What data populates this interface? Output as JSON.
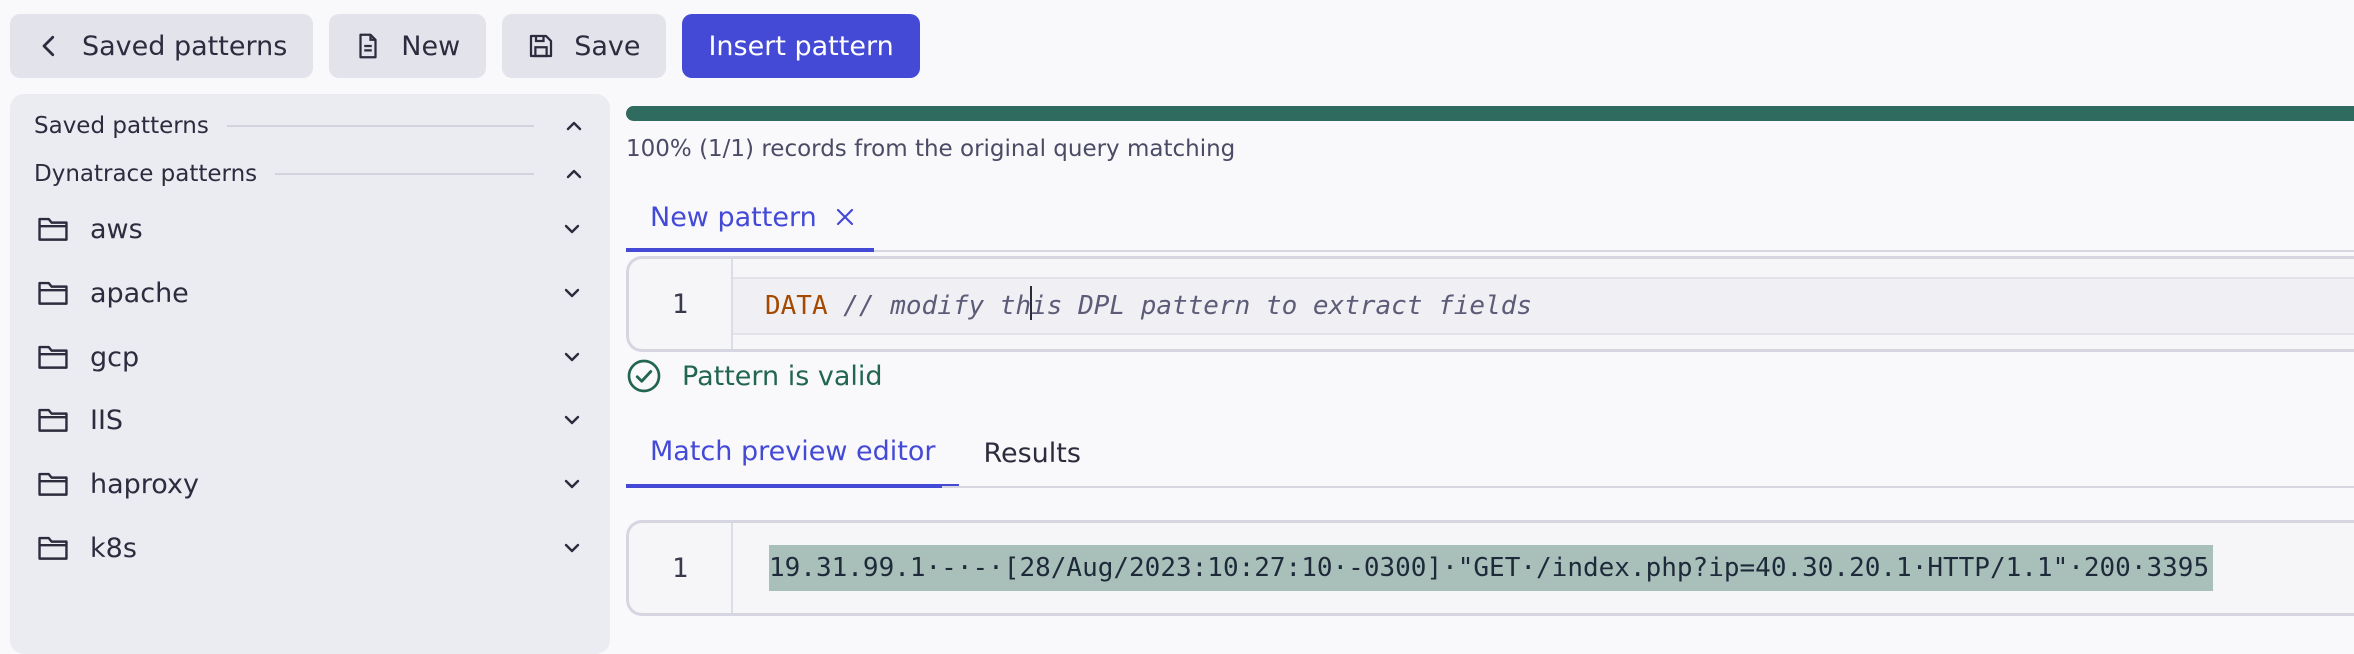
{
  "toolbar": {
    "saved_patterns_label": "Saved patterns",
    "new_label": "New",
    "save_label": "Save",
    "insert_label": "Insert pattern"
  },
  "sidebar": {
    "saved_section": "Saved patterns",
    "dynatrace_section": "Dynatrace patterns",
    "folders": [
      "aws",
      "apache",
      "gcp",
      "IIS",
      "haproxy",
      "k8s"
    ]
  },
  "main": {
    "match_progress": 1.0,
    "records_text": "100% (1/1) records from the original query matching",
    "pattern_tab": "New pattern",
    "editor": {
      "line_number": "1",
      "keyword": "DATA",
      "comment_before_caret": " // modify th",
      "comment_after_caret": "is DPL pattern to extract fields"
    },
    "validation": "Pattern is valid",
    "subtabs": [
      "Match preview editor",
      "Results"
    ],
    "preview": {
      "line_number": "1",
      "log_line": "19.31.99.1·-·-·[28/Aug/2023:10:27:10·-0300]·\"GET·/index.php?ip=40.30.20.1·HTTP/1.1\"·200·3395"
    }
  },
  "colors": {
    "accent": "#4449d6",
    "progress": "#2f6b5e",
    "valid": "#236650",
    "keyword": "#a34a00",
    "highlight": "#a9c0ba"
  }
}
